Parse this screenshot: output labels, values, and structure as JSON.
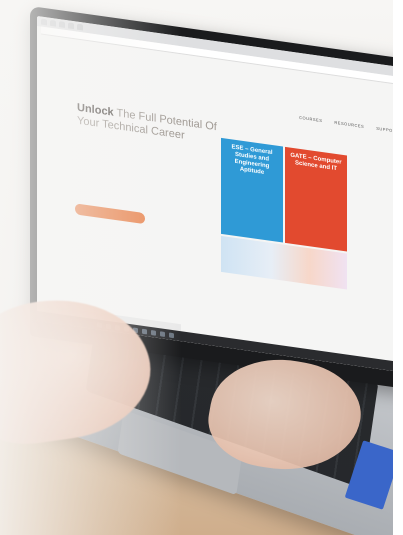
{
  "browser": {
    "tabs": [
      "",
      "",
      "",
      "",
      ""
    ],
    "address": ""
  },
  "site": {
    "logo": "",
    "nav": [
      "COURSES",
      "RESOURCES",
      "SUPPORT"
    ]
  },
  "hero": {
    "title_bold": "Unlock",
    "title_rest": " The Full Potential Of Your Technical Career",
    "subtitle": "",
    "cta": ""
  },
  "cards": [
    {
      "title": "ESE – General Studies and Engineering Aptitude",
      "desc": "",
      "count": "",
      "color": "#2f9ad6"
    },
    {
      "title": "GATE – Computer Science and IT",
      "desc": "",
      "count": "",
      "color": "#e24a2f"
    }
  ],
  "colors": {
    "cta": "#e98956",
    "card_blue": "#2f9ad6",
    "card_red": "#e24a2f"
  },
  "taskbar": {
    "icons": [
      "windows-icon",
      "search-icon",
      "task-view-icon",
      "edge-icon",
      "folder-icon",
      "store-icon",
      "mail-icon",
      "chrome-icon",
      "app-icon"
    ]
  }
}
